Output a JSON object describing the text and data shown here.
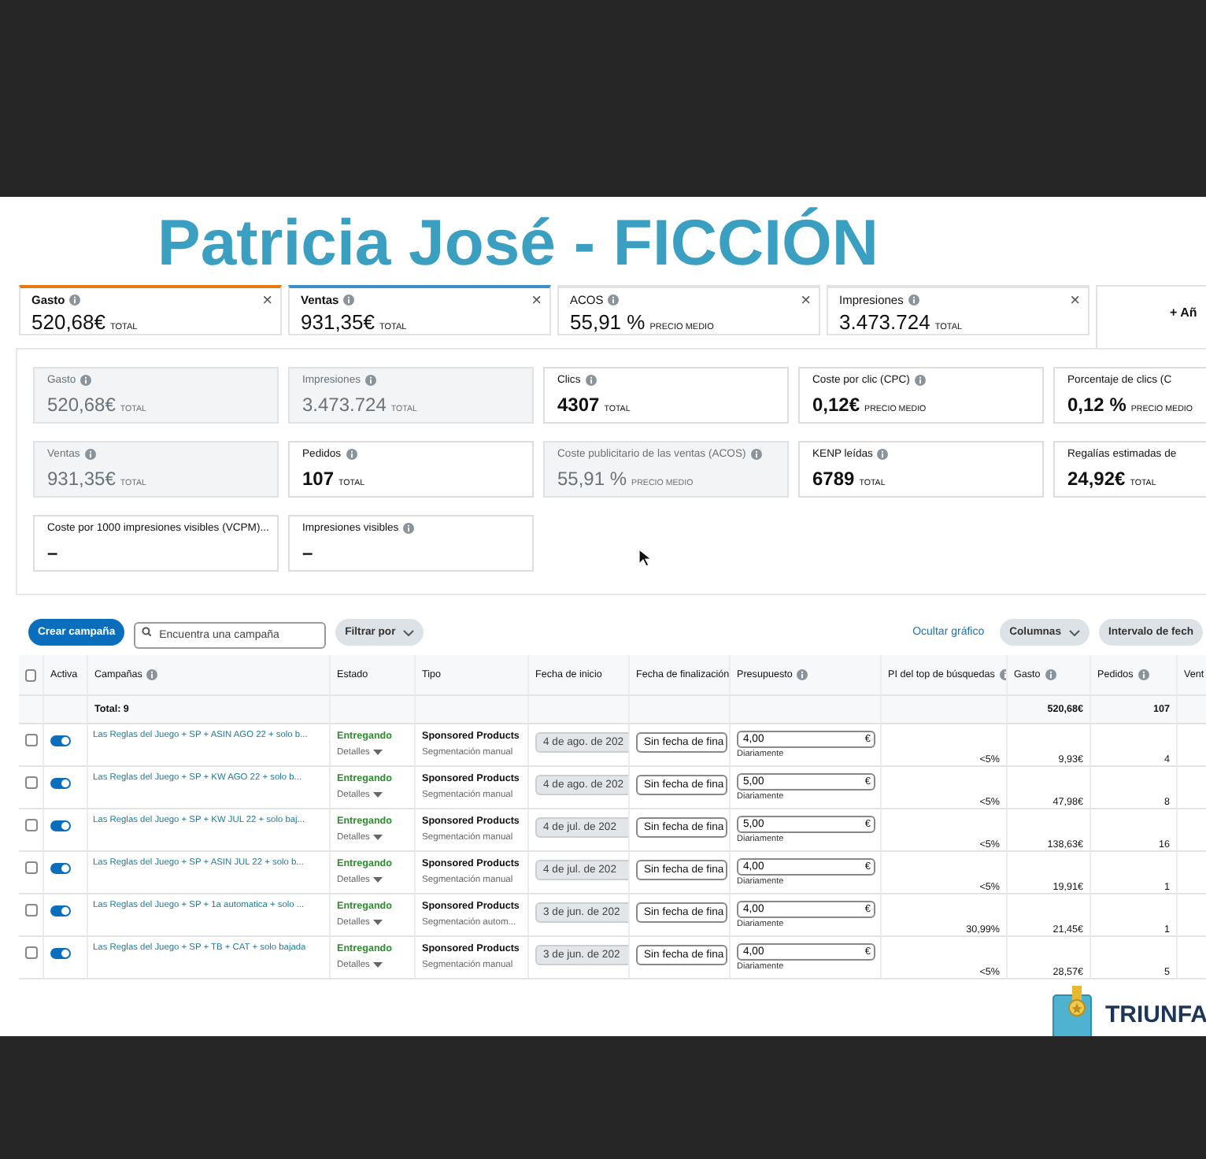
{
  "title": "Patricia José - FICCIÓN",
  "metric_tabs": [
    {
      "label": "Gasto",
      "value": "520,68€",
      "unit": "TOTAL",
      "color": "#e47911",
      "close": "×"
    },
    {
      "label": "Ventas",
      "value": "931,35€",
      "unit": "TOTAL",
      "color": "#3a8fc4",
      "close": "×"
    },
    {
      "label": "ACOS",
      "value": "55,91 %",
      "unit": "PRECIO MEDIO",
      "close": "×"
    },
    {
      "label": "Impresiones",
      "value": "3.473.724",
      "unit": "TOTAL",
      "close": "×"
    }
  ],
  "add_metric": "+ Añ",
  "metric_cards": [
    {
      "label": "Gasto",
      "value": "520,68€",
      "unit": "TOTAL",
      "selected": true,
      "info": true
    },
    {
      "label": "Impresiones",
      "value": "3.473.724",
      "unit": "TOTAL",
      "selected": true,
      "info": true
    },
    {
      "label": "Clics",
      "value": "4307",
      "unit": "TOTAL",
      "selected": false,
      "info": true
    },
    {
      "label": "Coste por clic (CPC)",
      "value": "0,12€",
      "unit": "PRECIO MEDIO",
      "selected": false,
      "info": true
    },
    {
      "label": "Porcentaje de clics (C",
      "value": "0,12 %",
      "unit": "PRECIO MEDIO",
      "selected": false,
      "info": false
    },
    {
      "label": "Ventas",
      "value": "931,35€",
      "unit": "TOTAL",
      "selected": true,
      "info": true
    },
    {
      "label": "Pedidos",
      "value": "107",
      "unit": "TOTAL",
      "selected": false,
      "info": true
    },
    {
      "label": "Coste publicitario de las ventas (ACOS)",
      "value": "55,91 %",
      "unit": "PRECIO MEDIO",
      "selected": true,
      "info": true
    },
    {
      "label": "KENP leídas",
      "value": "6789",
      "unit": "TOTAL",
      "selected": false,
      "info": true
    },
    {
      "label": "Regalías estimadas de",
      "value": "24,92€",
      "unit": "TOTAL",
      "selected": false,
      "info": false
    },
    {
      "label": "Coste por 1000 impresiones visibles (VCPM)...",
      "value": "–",
      "selected": false,
      "info": false
    },
    {
      "label": "Impresiones visibles",
      "value": "–",
      "selected": false,
      "info": true
    }
  ],
  "toolbar": {
    "create_button": "Crear campaña",
    "search": {
      "placeholder": "Encuentra una campaña"
    },
    "filter_button": "Filtrar por",
    "hide_chart_link": "Ocultar gráfico",
    "columns_button": "Columnas",
    "date_range_button": "Intervalo de fech"
  },
  "table": {
    "select_all": {
      "checked": false
    },
    "columns": [
      {
        "label": "Activa",
        "info": false
      },
      {
        "label": "Campañas",
        "info": true
      },
      {
        "label": "Estado",
        "info": false
      },
      {
        "label": "Tipo",
        "info": false
      },
      {
        "label": "Fecha de inicio",
        "info": false
      },
      {
        "label": "Fecha de finalización",
        "info": false
      },
      {
        "label": "Presupuesto",
        "info": true
      },
      {
        "label": "PI del top de búsquedas",
        "info": true
      },
      {
        "label": "Gasto",
        "info": true
      },
      {
        "label": "Pedidos",
        "info": true
      },
      {
        "label": "Vent",
        "info": false
      }
    ],
    "total": {
      "label": "Total: 9",
      "gasto": "520,68€",
      "pedidos": "107"
    },
    "rows": [
      {
        "checked": false,
        "on": true,
        "campaign": "Las Reglas del Juego + SP + ASIN AGO 22 + solo b...",
        "status": "Entregando",
        "details": "Detalles",
        "type": "Sponsored Products",
        "targeting": "Segmentación manual",
        "start": "4 de ago. de 202",
        "end": "Sin fecha de fina",
        "budget": "4,00",
        "currency": "€",
        "period": "Diariamente",
        "pi": "<5%",
        "gasto": "9,93€",
        "pedidos": "4"
      },
      {
        "checked": false,
        "on": true,
        "campaign": "Las Reglas del Juego + SP +  KW AGO 22 + solo b...",
        "status": "Entregando",
        "details": "Detalles",
        "type": "Sponsored Products",
        "targeting": "Segmentación manual",
        "start": "4 de ago. de 202",
        "end": "Sin fecha de fina",
        "budget": "5,00",
        "currency": "€",
        "period": "Diariamente",
        "pi": "<5%",
        "gasto": "47,98€",
        "pedidos": "8"
      },
      {
        "checked": false,
        "on": true,
        "campaign": "Las Reglas del Juego + SP +  KW JUL 22 + solo baj...",
        "status": "Entregando",
        "details": "Detalles",
        "type": "Sponsored Products",
        "targeting": "Segmentación manual",
        "start": "4 de jul. de 202",
        "end": "Sin fecha de fina",
        "budget": "5,00",
        "currency": "€",
        "period": "Diariamente",
        "pi": "<5%",
        "gasto": "138,63€",
        "pedidos": "16"
      },
      {
        "checked": false,
        "on": true,
        "campaign": "Las Reglas del Juego + SP + ASIN JUL 22 + solo b...",
        "status": "Entregando",
        "details": "Detalles",
        "type": "Sponsored Products",
        "targeting": "Segmentación manual",
        "start": "4 de jul. de 202",
        "end": "Sin fecha de fina",
        "budget": "4,00",
        "currency": "€",
        "period": "Diariamente",
        "pi": "<5%",
        "gasto": "19,91€",
        "pedidos": "1"
      },
      {
        "checked": false,
        "on": true,
        "campaign": "Las Reglas del Juego + SP + 1a automatica + solo ...",
        "status": "Entregando",
        "details": "Detalles",
        "type": "Sponsored Products",
        "targeting": "Segmentación autom...",
        "start": "3 de jun. de 202",
        "end": "Sin fecha de fina",
        "budget": "4,00",
        "currency": "€",
        "period": "Diariamente",
        "pi": "30,99%",
        "gasto": "21,45€",
        "pedidos": "1"
      },
      {
        "checked": false,
        "on": true,
        "campaign": "Las Reglas del Juego + SP + TB + CAT + solo bajada",
        "status": "Entregando",
        "details": "Detalles",
        "type": "Sponsored Products",
        "targeting": "Segmentación manual",
        "start": "3 de jun. de 202",
        "end": "Sin fecha de fina",
        "budget": "4,00",
        "currency": "€",
        "period": "Diariamente",
        "pi": "<5%",
        "gasto": "28,57€",
        "pedidos": "5"
      }
    ]
  },
  "logo": {
    "text": "TRIUNFA"
  }
}
